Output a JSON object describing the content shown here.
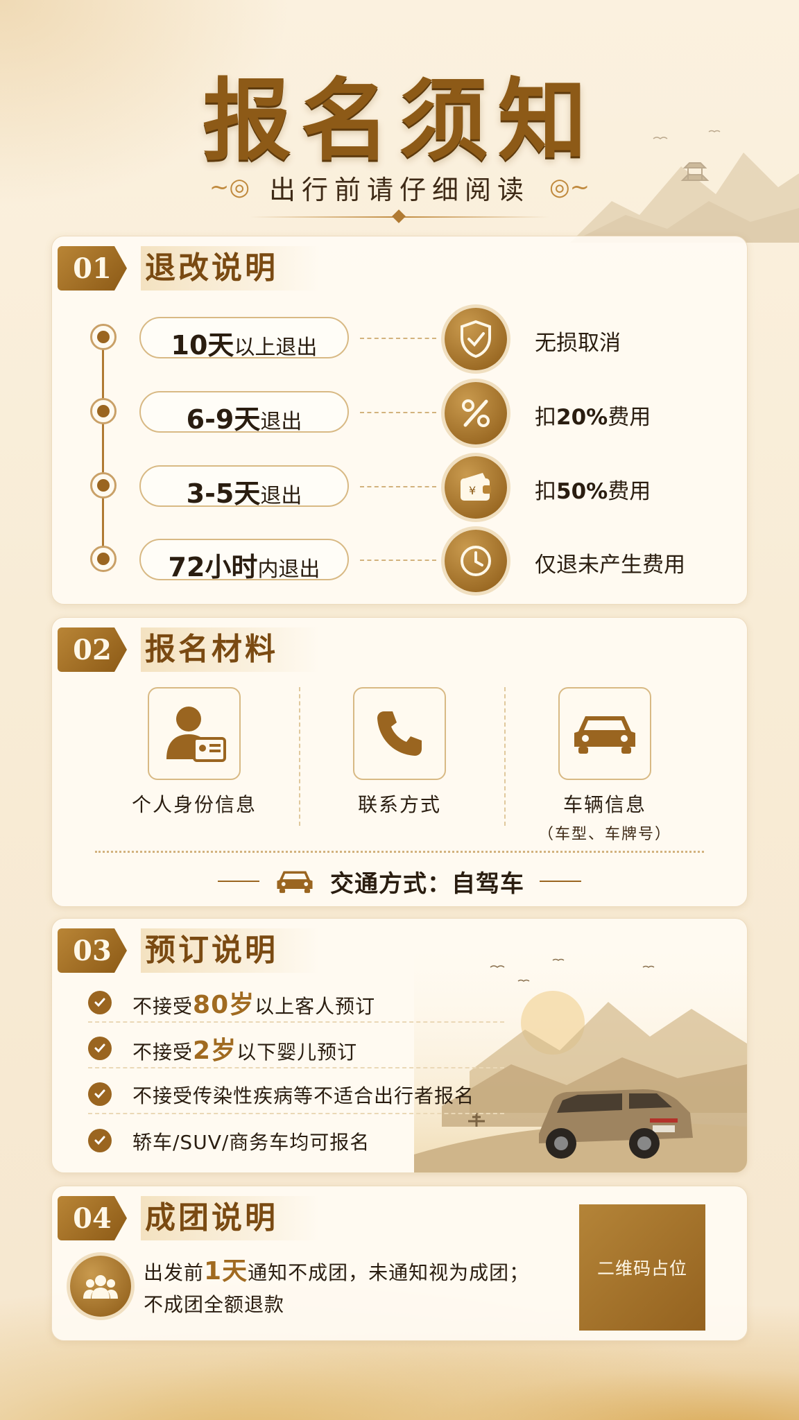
{
  "header": {
    "title": "报名须知",
    "subtitle": "出行前请仔细阅读"
  },
  "sections": [
    {
      "num": "01",
      "title": "退改说明",
      "rows": [
        {
          "big": "10天",
          "small": "以上退出",
          "icon": "shield-check-icon",
          "result_prefix": "",
          "result_bold": "",
          "result_suffix": "无损取消"
        },
        {
          "big": "6-9天",
          "small": "退出",
          "icon": "percent-icon",
          "result_prefix": "扣",
          "result_bold": "20%",
          "result_suffix": "费用"
        },
        {
          "big": "3-5天",
          "small": "退出",
          "icon": "wallet-icon",
          "result_prefix": "扣",
          "result_bold": "50%",
          "result_suffix": "费用"
        },
        {
          "big": "72小时",
          "small": "内退出",
          "icon": "clock-icon",
          "result_prefix": "",
          "result_bold": "",
          "result_suffix": "仅退未产生费用"
        }
      ]
    },
    {
      "num": "02",
      "title": "报名材料",
      "materials": [
        {
          "label": "个人身份信息",
          "icon": "id-card-icon",
          "note": ""
        },
        {
          "label": "联系方式",
          "icon": "phone-icon",
          "note": ""
        },
        {
          "label": "车辆信息",
          "icon": "car-icon",
          "note": "（车型、车牌号）"
        }
      ],
      "transport": "交通方式：自驾车"
    },
    {
      "num": "03",
      "title": "预订说明",
      "items": [
        {
          "pre": "不接受",
          "em": "80岁",
          "post": "以上客人预订"
        },
        {
          "pre": "不接受",
          "em": "2岁",
          "post": "以下婴儿预订"
        },
        {
          "pre": "不接受传染性疾病等不适合出行者报名",
          "em": "",
          "post": ""
        },
        {
          "pre": "轿车/SUV/商务车均可报名",
          "em": "",
          "post": ""
        }
      ]
    },
    {
      "num": "04",
      "title": "成团说明",
      "line1_pre": "出发前",
      "line1_em": "1天",
      "line1_post": "通知不成团，未通知视为成团；",
      "line2": "不成团全额退款",
      "qr_label": "二维码占位"
    }
  ],
  "colors": {
    "gold_dark": "#8c5a16",
    "gold": "#b98536",
    "accent_text": "#a06a20",
    "background": "#f8ecd6"
  }
}
